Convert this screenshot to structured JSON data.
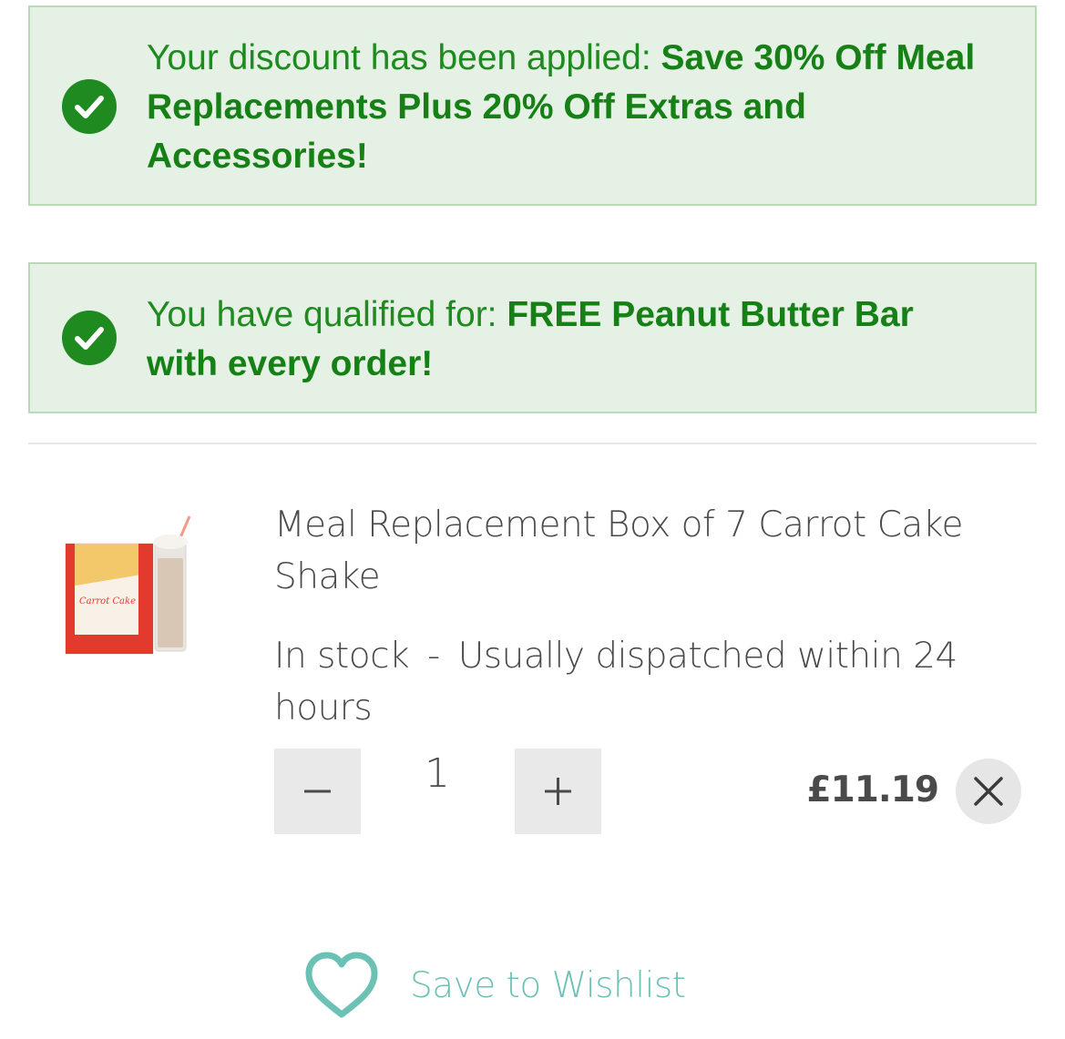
{
  "banners": [
    {
      "prefix": "Your discount has been applied: ",
      "highlight": "Save 30% Off Meal Replacements Plus 20% Off Extras and Accessories!",
      "icon": "check-circle-icon"
    },
    {
      "prefix": "You have qualified for: ",
      "highlight": "FREE Peanut Butter Bar with every order!",
      "icon": "check-circle-icon"
    }
  ],
  "cart_item": {
    "title": "Meal Replacement Box of 7 Carrot Cake Shake",
    "stock_status": "In stock",
    "separator": "-",
    "dispatch": "Usually dispatched within 24 hours",
    "quantity": "1",
    "price": "£11.19",
    "image_label": "Carrot Cake"
  },
  "wishlist": {
    "label": "Save to Wishlist",
    "icon": "heart-icon"
  },
  "colors": {
    "banner_bg": "#e5f1e5",
    "banner_text": "#1f8a1f",
    "accent": "#6cc1b5"
  }
}
